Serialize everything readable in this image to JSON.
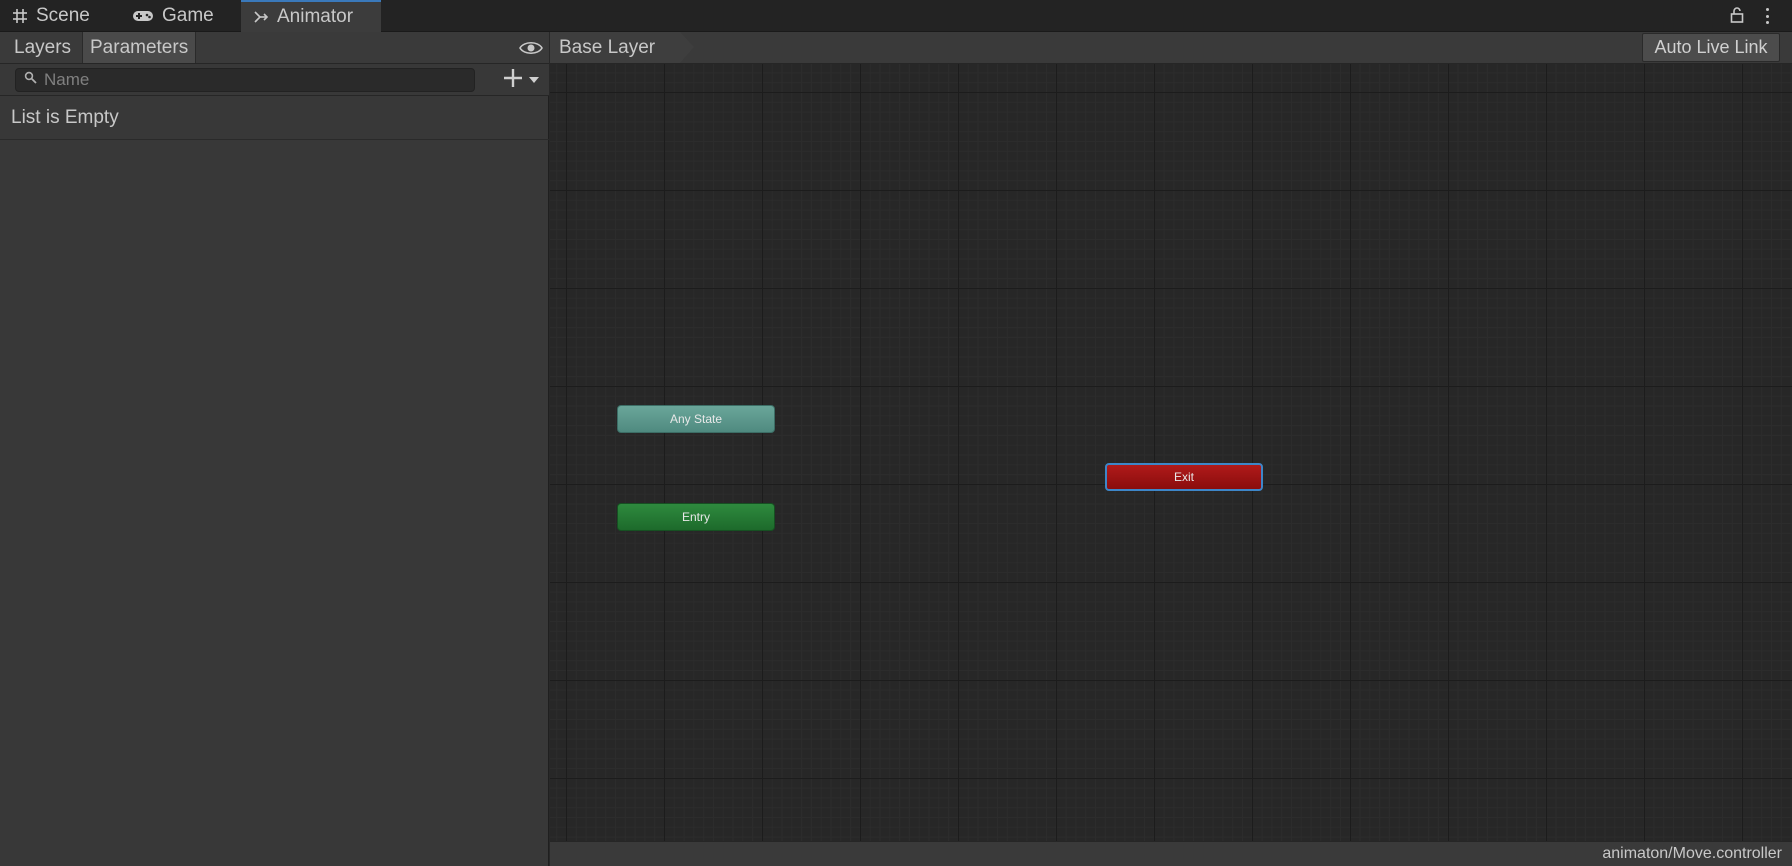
{
  "tabs": [
    {
      "label": "Scene",
      "icon": "grid-hash-icon"
    },
    {
      "label": "Game",
      "icon": "gamepad-icon"
    },
    {
      "label": "Animator",
      "icon": "animator-icon",
      "active": true
    }
  ],
  "left_panel": {
    "tabs": [
      "Layers",
      "Parameters"
    ],
    "active_tab": "Parameters",
    "search": {
      "placeholder": "Name",
      "value": ""
    },
    "empty_message": "List is Empty"
  },
  "graph": {
    "breadcrumb": "Base Layer",
    "live_link_label": "Auto Live Link",
    "nodes": {
      "any_state": "Any State",
      "entry": "Entry",
      "exit": "Exit"
    },
    "footer_path": "animaton/Move.controller"
  },
  "colors": {
    "active_tab_accent": "#3a79bb",
    "any_state_node": "#5f9a8f",
    "entry_node": "#237a34",
    "exit_node": "#9e1212",
    "exit_highlight": "#3d86c8"
  }
}
